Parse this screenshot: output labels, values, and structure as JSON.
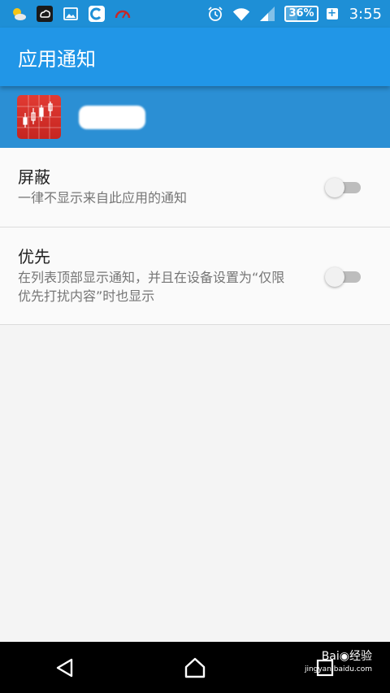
{
  "status_bar": {
    "battery_percent": "36%",
    "battery_level": 0.36,
    "charging_plus": "+",
    "time": "3:55",
    "icons_left": [
      "weather-icon",
      "cloud-app-icon",
      "gallery-icon",
      "browser-c-icon",
      "speedometer-icon"
    ],
    "icons_right": [
      "alarm-icon",
      "wifi-icon",
      "signal-icon",
      "battery-icon"
    ]
  },
  "action_bar": {
    "title": "应用通知"
  },
  "app_header": {
    "app_name": "▬▬▬"
  },
  "settings": [
    {
      "title": "屏蔽",
      "description": "一律不显示来自此应用的通知",
      "enabled": false
    },
    {
      "title": "优先",
      "description": "在列表顶部显示通知，并且在设备设置为“仅限优先打扰内容”时也显示",
      "enabled": false
    }
  ],
  "watermark": {
    "brand": "Bai◉经验",
    "url": "jingyan.baidu.com"
  },
  "colors": {
    "status_bar": "#1e8fd6",
    "action_bar": "#2196e7",
    "app_header": "#2b8fd4",
    "accent_icon": "#e23b33"
  }
}
